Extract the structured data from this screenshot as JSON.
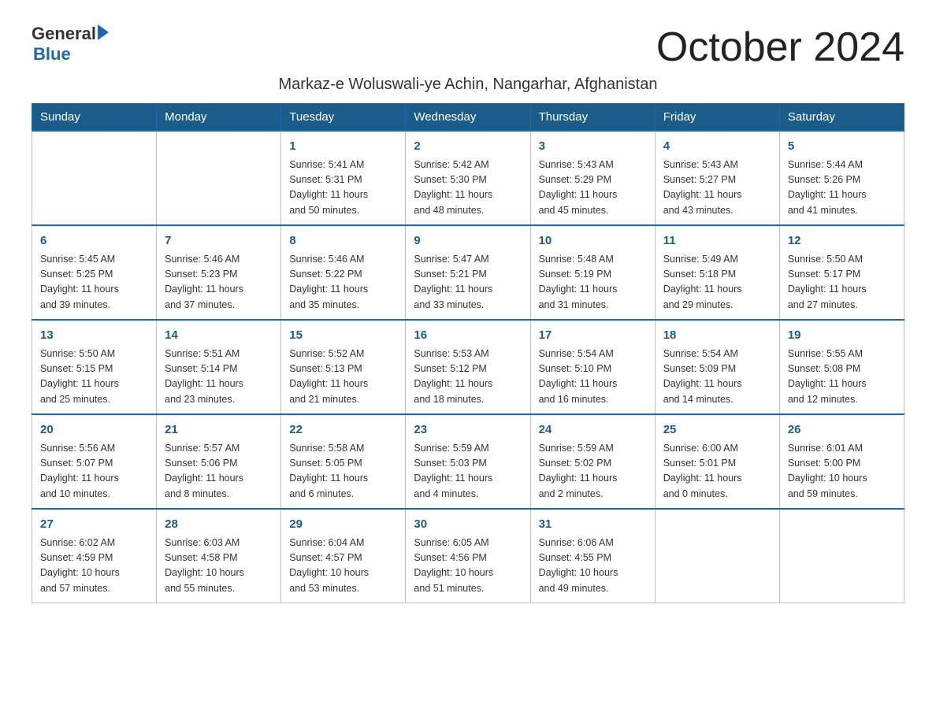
{
  "header": {
    "logo_general": "General",
    "logo_blue": "Blue",
    "month_title": "October 2024",
    "subtitle": "Markaz-e Woluswali-ye Achin, Nangarhar, Afghanistan"
  },
  "days_of_week": [
    "Sunday",
    "Monday",
    "Tuesday",
    "Wednesday",
    "Thursday",
    "Friday",
    "Saturday"
  ],
  "weeks": [
    [
      {
        "day": "",
        "info": ""
      },
      {
        "day": "",
        "info": ""
      },
      {
        "day": "1",
        "info": "Sunrise: 5:41 AM\nSunset: 5:31 PM\nDaylight: 11 hours\nand 50 minutes."
      },
      {
        "day": "2",
        "info": "Sunrise: 5:42 AM\nSunset: 5:30 PM\nDaylight: 11 hours\nand 48 minutes."
      },
      {
        "day": "3",
        "info": "Sunrise: 5:43 AM\nSunset: 5:29 PM\nDaylight: 11 hours\nand 45 minutes."
      },
      {
        "day": "4",
        "info": "Sunrise: 5:43 AM\nSunset: 5:27 PM\nDaylight: 11 hours\nand 43 minutes."
      },
      {
        "day": "5",
        "info": "Sunrise: 5:44 AM\nSunset: 5:26 PM\nDaylight: 11 hours\nand 41 minutes."
      }
    ],
    [
      {
        "day": "6",
        "info": "Sunrise: 5:45 AM\nSunset: 5:25 PM\nDaylight: 11 hours\nand 39 minutes."
      },
      {
        "day": "7",
        "info": "Sunrise: 5:46 AM\nSunset: 5:23 PM\nDaylight: 11 hours\nand 37 minutes."
      },
      {
        "day": "8",
        "info": "Sunrise: 5:46 AM\nSunset: 5:22 PM\nDaylight: 11 hours\nand 35 minutes."
      },
      {
        "day": "9",
        "info": "Sunrise: 5:47 AM\nSunset: 5:21 PM\nDaylight: 11 hours\nand 33 minutes."
      },
      {
        "day": "10",
        "info": "Sunrise: 5:48 AM\nSunset: 5:19 PM\nDaylight: 11 hours\nand 31 minutes."
      },
      {
        "day": "11",
        "info": "Sunrise: 5:49 AM\nSunset: 5:18 PM\nDaylight: 11 hours\nand 29 minutes."
      },
      {
        "day": "12",
        "info": "Sunrise: 5:50 AM\nSunset: 5:17 PM\nDaylight: 11 hours\nand 27 minutes."
      }
    ],
    [
      {
        "day": "13",
        "info": "Sunrise: 5:50 AM\nSunset: 5:15 PM\nDaylight: 11 hours\nand 25 minutes."
      },
      {
        "day": "14",
        "info": "Sunrise: 5:51 AM\nSunset: 5:14 PM\nDaylight: 11 hours\nand 23 minutes."
      },
      {
        "day": "15",
        "info": "Sunrise: 5:52 AM\nSunset: 5:13 PM\nDaylight: 11 hours\nand 21 minutes."
      },
      {
        "day": "16",
        "info": "Sunrise: 5:53 AM\nSunset: 5:12 PM\nDaylight: 11 hours\nand 18 minutes."
      },
      {
        "day": "17",
        "info": "Sunrise: 5:54 AM\nSunset: 5:10 PM\nDaylight: 11 hours\nand 16 minutes."
      },
      {
        "day": "18",
        "info": "Sunrise: 5:54 AM\nSunset: 5:09 PM\nDaylight: 11 hours\nand 14 minutes."
      },
      {
        "day": "19",
        "info": "Sunrise: 5:55 AM\nSunset: 5:08 PM\nDaylight: 11 hours\nand 12 minutes."
      }
    ],
    [
      {
        "day": "20",
        "info": "Sunrise: 5:56 AM\nSunset: 5:07 PM\nDaylight: 11 hours\nand 10 minutes."
      },
      {
        "day": "21",
        "info": "Sunrise: 5:57 AM\nSunset: 5:06 PM\nDaylight: 11 hours\nand 8 minutes."
      },
      {
        "day": "22",
        "info": "Sunrise: 5:58 AM\nSunset: 5:05 PM\nDaylight: 11 hours\nand 6 minutes."
      },
      {
        "day": "23",
        "info": "Sunrise: 5:59 AM\nSunset: 5:03 PM\nDaylight: 11 hours\nand 4 minutes."
      },
      {
        "day": "24",
        "info": "Sunrise: 5:59 AM\nSunset: 5:02 PM\nDaylight: 11 hours\nand 2 minutes."
      },
      {
        "day": "25",
        "info": "Sunrise: 6:00 AM\nSunset: 5:01 PM\nDaylight: 11 hours\nand 0 minutes."
      },
      {
        "day": "26",
        "info": "Sunrise: 6:01 AM\nSunset: 5:00 PM\nDaylight: 10 hours\nand 59 minutes."
      }
    ],
    [
      {
        "day": "27",
        "info": "Sunrise: 6:02 AM\nSunset: 4:59 PM\nDaylight: 10 hours\nand 57 minutes."
      },
      {
        "day": "28",
        "info": "Sunrise: 6:03 AM\nSunset: 4:58 PM\nDaylight: 10 hours\nand 55 minutes."
      },
      {
        "day": "29",
        "info": "Sunrise: 6:04 AM\nSunset: 4:57 PM\nDaylight: 10 hours\nand 53 minutes."
      },
      {
        "day": "30",
        "info": "Sunrise: 6:05 AM\nSunset: 4:56 PM\nDaylight: 10 hours\nand 51 minutes."
      },
      {
        "day": "31",
        "info": "Sunrise: 6:06 AM\nSunset: 4:55 PM\nDaylight: 10 hours\nand 49 minutes."
      },
      {
        "day": "",
        "info": ""
      },
      {
        "day": "",
        "info": ""
      }
    ]
  ]
}
